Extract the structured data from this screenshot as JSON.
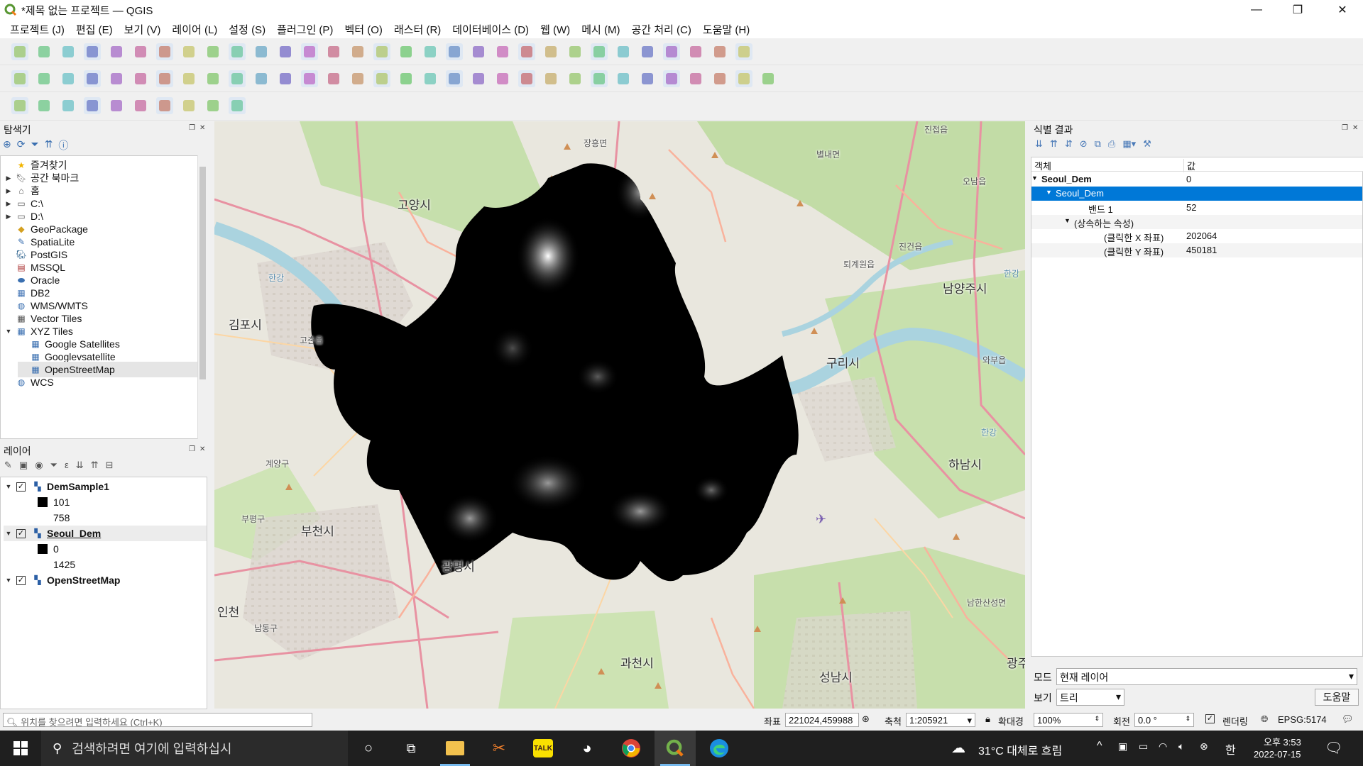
{
  "window": {
    "title": "*제목 없는 프로젝트 — QGIS",
    "minimize": "—",
    "restore": "❐",
    "close": "✕"
  },
  "menu": [
    "프로젝트 (J)",
    "편집 (E)",
    "보기 (V)",
    "레이어 (L)",
    "설정 (S)",
    "플러그인 (P)",
    "벡터 (O)",
    "래스터 (R)",
    "데이터베이스 (D)",
    "웹 (W)",
    "메시 (M)",
    "공간 처리 (C)",
    "도움말 (H)"
  ],
  "browser": {
    "title": "탐색기",
    "items": [
      {
        "label": "즐겨찾기",
        "icon": "star-icon",
        "expander": ""
      },
      {
        "label": "공간 북마크",
        "icon": "bookmark-icon",
        "expander": "▶"
      },
      {
        "label": "홈",
        "icon": "home-folder-icon",
        "expander": "▶"
      },
      {
        "label": "C:\\",
        "icon": "drive-icon",
        "expander": "▶"
      },
      {
        "label": "D:\\",
        "icon": "drive-icon",
        "expander": "▶"
      },
      {
        "label": "GeoPackage",
        "icon": "geopackage-icon",
        "expander": ""
      },
      {
        "label": "SpatiaLite",
        "icon": "spatialite-icon",
        "expander": ""
      },
      {
        "label": "PostGIS",
        "icon": "postgis-icon",
        "expander": ""
      },
      {
        "label": "MSSQL",
        "icon": "mssql-icon",
        "expander": ""
      },
      {
        "label": "Oracle",
        "icon": "oracle-icon",
        "expander": ""
      },
      {
        "label": "DB2",
        "icon": "db2-icon",
        "expander": ""
      },
      {
        "label": "WMS/WMTS",
        "icon": "wms-icon",
        "expander": ""
      },
      {
        "label": "Vector Tiles",
        "icon": "vector-tiles-icon",
        "expander": ""
      },
      {
        "label": "XYZ Tiles",
        "icon": "xyz-tiles-icon",
        "expander": "▼"
      },
      {
        "label": "Google Satellites",
        "icon": "xyz-tiles-icon",
        "expander": ""
      },
      {
        "label": "Googlevsatellite",
        "icon": "xyz-tiles-icon",
        "expander": ""
      },
      {
        "label": "OpenStreetMap",
        "icon": "xyz-tiles-icon",
        "expander": ""
      },
      {
        "label": "WCS",
        "icon": "wcs-icon",
        "expander": ""
      }
    ]
  },
  "layers": {
    "title": "레이어",
    "items": [
      {
        "name": "DemSample1",
        "min": "101",
        "max": "758",
        "checked": "✓"
      },
      {
        "name": "Seoul_Dem",
        "min": "0",
        "max": "1425",
        "checked": "✓"
      },
      {
        "name": "OpenStreetMap",
        "checked": "✓"
      }
    ]
  },
  "map_labels": {
    "goyang": "고양시",
    "gimpo": "김포시",
    "guri": "구리시",
    "namyangju": "남양주시",
    "hanam": "하남시",
    "bucheon": "부천시",
    "gwangmyeong": "광명시",
    "gwacheon": "과천시",
    "seongnam": "성남시",
    "incheon": "인천",
    "namhansanseong": "남한산성면",
    "jinjeop": "진접읍",
    "byeollae": "별내면",
    "toegyewon": "퇴계원읍",
    "jingeon": "진건읍",
    "onam": "오남읍",
    "jangheung": "장흥면",
    "gochon": "고촌읍",
    "gyeyang": "계양구",
    "bupyeong": "부평구",
    "namdong": "남동구",
    "wabu": "와부읍",
    "gwang": "광주",
    "han1": "한강",
    "han2": "한강",
    "han3": "한강"
  },
  "identify": {
    "title": "식별 결과",
    "col_feature": "객체",
    "col_value": "값",
    "rows": [
      {
        "label": "Seoul_Dem",
        "value": "0"
      },
      {
        "label": "Seoul_Dem",
        "value": ""
      },
      {
        "label": "밴드 1",
        "value": "52"
      },
      {
        "label": "(상속하는 속성)",
        "value": ""
      },
      {
        "label": "(클릭한 X 좌표)",
        "value": "202064"
      },
      {
        "label": "(클릭한 Y 좌표)",
        "value": "450181"
      }
    ],
    "mode_label": "모드",
    "mode_value": "현재 레이어",
    "view_label": "보기",
    "view_value": "트리",
    "help_button": "도움말"
  },
  "status": {
    "locator_placeholder": "위치를 찾으려면 입력하세요 (Ctrl+K)",
    "coord_label": "좌표",
    "coord_value": "221024,459988",
    "scale_label": "축척",
    "scale_value": "1:205921",
    "magnifier_label": "확대경",
    "magnifier_value": "100%",
    "rotation_label": "회전",
    "rotation_value": "0.0 °",
    "render_label": "렌더링",
    "crs": "EPSG:5174"
  },
  "taskbar": {
    "search_placeholder": "검색하려면 여기에 입력하십시",
    "weather": "31°C 대체로 흐림",
    "ime": "한",
    "time": "오후 3:53",
    "date": "2022-07-15"
  },
  "colors": {
    "selection": "#0078d7",
    "qgis_green": "#589632",
    "taskbar": "#1f1f1f"
  }
}
